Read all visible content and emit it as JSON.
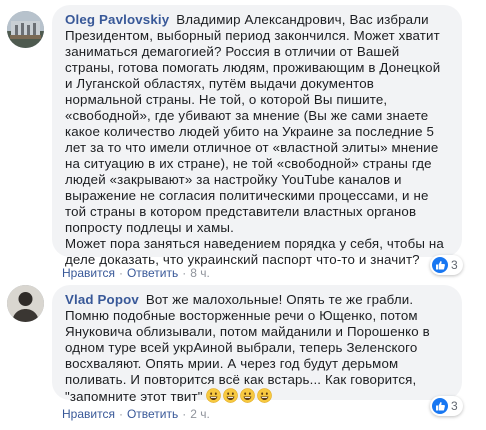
{
  "comments": [
    {
      "author": "Oleg Pavlovskiy",
      "text": "Владимир Александрович, Вас избрали Президентом, выборный период закончился. Может хватит заниматься демагогией? Россия в отличии от Вашей страны, готова помогать людям, проживающим в Донецкой и Луганской областях, путём выдачи документов нормальной страны. Не той, о которой Вы пишите, «свободной», где убивают за мнение (Вы же сами знаете какое количество людей убито на Украине за последние 5 лет за то что имели отличное от «властной элиты» мнение на ситуацию в их стране), не той «свободной» страны где людей «закрывают» за настройку YouTube каналов и выражение не согласия политическими процессами, и не той страны в котором представители властных органов попросту подлецы и хамы.",
      "text2": "Может пора заняться наведением порядка у себя, чтобы на деле доказать, что украинский паспорт что-то и значит?",
      "like_label": "Нравится",
      "reply_label": "Ответить",
      "time": "8 ч.",
      "reactions_count": "3",
      "reaction_icon": "like-icon"
    },
    {
      "author": "Vlad Popov",
      "text": "Вот же малохольные! Опять те же грабли. Помню подобные восторженные речи о Ющенко, потом Януковича облизывали, потом майданили и Порошенко в одном туре всей укрАиной выбрали, теперь Зеленского восхваляют. Опять мрии. А через год будут дерьмом поливать. И повторится всё как встарь... Как говорится, \"запомните этот твит\"",
      "emoji_count": 4,
      "emoji_name": "grinning-face-emoji",
      "like_label": "Нравится",
      "reply_label": "Ответить",
      "time": "2 ч.",
      "reactions_count": "3",
      "reaction_icon": "like-icon"
    }
  ],
  "colors": {
    "author": "#385898",
    "bubble": "#f2f3f5",
    "meta": "#606770",
    "like": "#1877f2"
  }
}
